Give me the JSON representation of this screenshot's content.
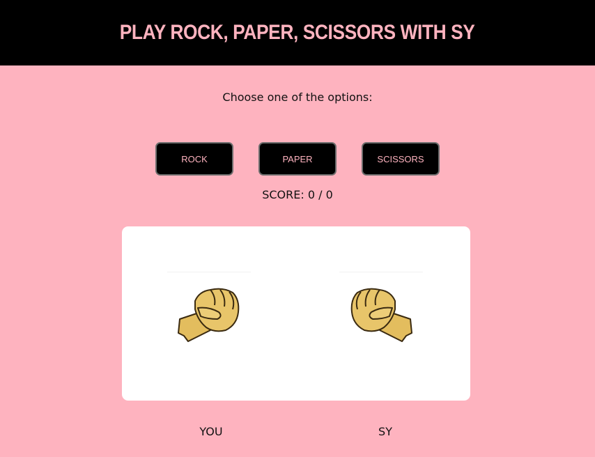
{
  "header": {
    "title": "PLAY ROCK, PAPER, SCISSORS WITH SY"
  },
  "prompt": "Choose one of the options:",
  "choices": [
    {
      "label": "ROCK"
    },
    {
      "label": "PAPER"
    },
    {
      "label": "SCISSORS"
    }
  ],
  "score": {
    "text": "SCORE: 0 / 0"
  },
  "arena": {
    "player_hand_icon": "fist-icon",
    "opponent_hand_icon": "fist-icon"
  },
  "players": {
    "you": "YOU",
    "opponent": "SY"
  },
  "colors": {
    "background": "#feb3bf",
    "header_bg": "#000000",
    "accent_text": "#feb3bf",
    "fist_fill": "#e8c56a"
  }
}
